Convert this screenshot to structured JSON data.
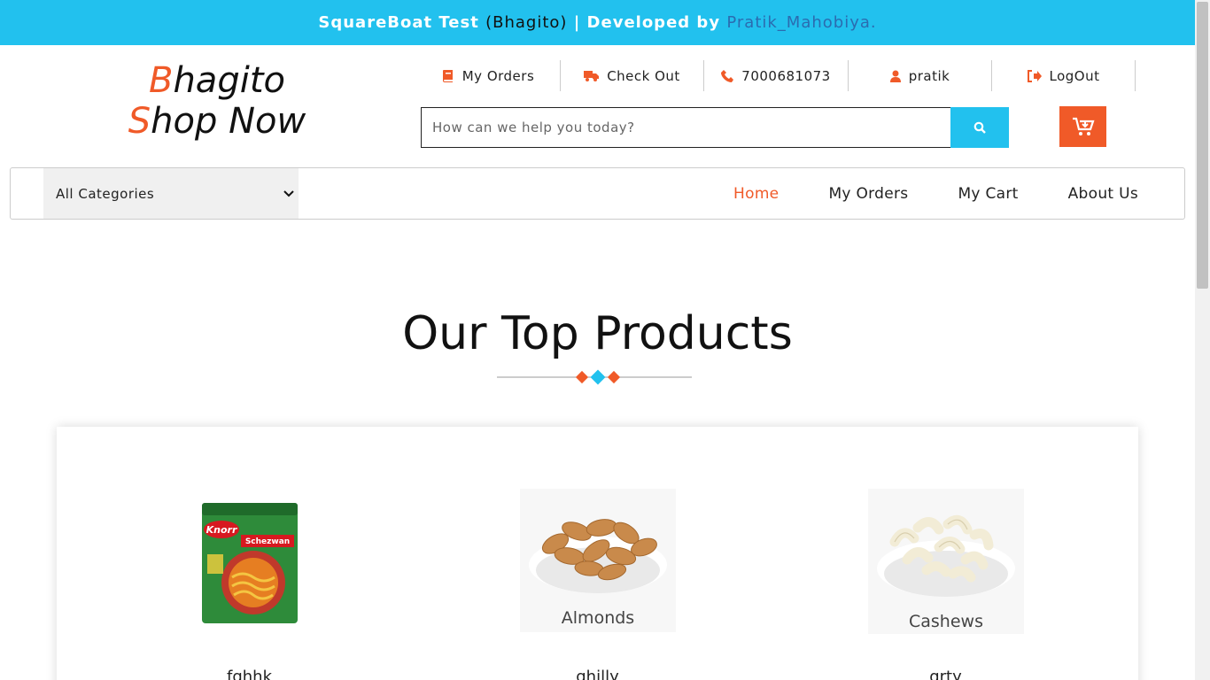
{
  "banner": {
    "prefix": "SquareBoat Test",
    "project": "(Bhagito)",
    "developed": "| Developed by",
    "author": "Pratik_Mahobiya."
  },
  "logo": {
    "line1_first": "B",
    "line1_rest": "hagito",
    "line2_first": "S",
    "line2_rest": "hop Now"
  },
  "header_links": [
    {
      "label": "My Orders",
      "icon": "book-icon"
    },
    {
      "label": "Check Out",
      "icon": "truck-icon"
    },
    {
      "label": "7000681073",
      "icon": "phone-icon"
    },
    {
      "label": "pratik",
      "icon": "user-icon"
    },
    {
      "label": "LogOut",
      "icon": "sign-out-icon"
    }
  ],
  "search": {
    "placeholder": "How can we help you today?",
    "icon": "search-icon"
  },
  "cart": {
    "icon": "cart-download-icon"
  },
  "nav": {
    "category_select": "All Categories",
    "links": [
      "Home",
      "My Orders",
      "My Cart",
      "About Us"
    ],
    "active": "Home"
  },
  "section": {
    "title": "Our Top Products"
  },
  "products": [
    {
      "name": "fghhk",
      "image_label": "Knorr",
      "image_sublabel": "Schezwan"
    },
    {
      "name": "ghilly",
      "image_label": "Almonds"
    },
    {
      "name": "qrty",
      "image_label": "Cashews"
    }
  ],
  "colors": {
    "accent": "#f05a28",
    "banner": "#22c1ee"
  }
}
